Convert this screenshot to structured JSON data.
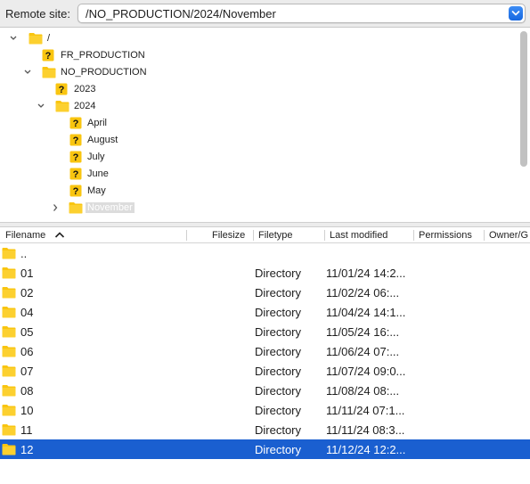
{
  "remote_site": {
    "label": "Remote site:",
    "path": "/NO_PRODUCTION/2024/November"
  },
  "tree": {
    "items": [
      {
        "label": "/",
        "icon": "folder-icon",
        "expanded": true
      },
      {
        "label": "FR_PRODUCTION",
        "icon": "unknown-folder-icon"
      },
      {
        "label": "NO_PRODUCTION",
        "icon": "folder-icon",
        "expanded": true
      },
      {
        "label": "2023",
        "icon": "unknown-folder-icon"
      },
      {
        "label": "2024",
        "icon": "folder-icon",
        "expanded": true
      },
      {
        "label": "April",
        "icon": "unknown-folder-icon"
      },
      {
        "label": "August",
        "icon": "unknown-folder-icon"
      },
      {
        "label": "July",
        "icon": "unknown-folder-icon"
      },
      {
        "label": "June",
        "icon": "unknown-folder-icon"
      },
      {
        "label": "May",
        "icon": "unknown-folder-icon"
      },
      {
        "label": "November",
        "icon": "folder-icon",
        "selected": true,
        "collapsed": true
      }
    ]
  },
  "file_list": {
    "columns": [
      "Filename",
      "Filesize",
      "Filetype",
      "Last modified",
      "Permissions",
      "Owner/G"
    ],
    "rows": [
      {
        "name": "..",
        "type": "",
        "modified": ""
      },
      {
        "name": "01",
        "type": "Directory",
        "modified": "11/01/24 14:2..."
      },
      {
        "name": "02",
        "type": "Directory",
        "modified": "11/02/24 06:..."
      },
      {
        "name": "04",
        "type": "Directory",
        "modified": "11/04/24 14:1..."
      },
      {
        "name": "05",
        "type": "Directory",
        "modified": "11/05/24 16:..."
      },
      {
        "name": "06",
        "type": "Directory",
        "modified": "11/06/24 07:..."
      },
      {
        "name": "07",
        "type": "Directory",
        "modified": "11/07/24 09:0..."
      },
      {
        "name": "08",
        "type": "Directory",
        "modified": "11/08/24 08:..."
      },
      {
        "name": "10",
        "type": "Directory",
        "modified": "11/11/24 07:1..."
      },
      {
        "name": "11",
        "type": "Directory",
        "modified": "11/11/24 08:3..."
      },
      {
        "name": "12",
        "type": "Directory",
        "modified": "11/12/24 12:2...",
        "selected": true
      }
    ]
  },
  "colors": {
    "selection": "#1a5fd0",
    "folder": "#f9c510",
    "accent": "#1667e0"
  }
}
